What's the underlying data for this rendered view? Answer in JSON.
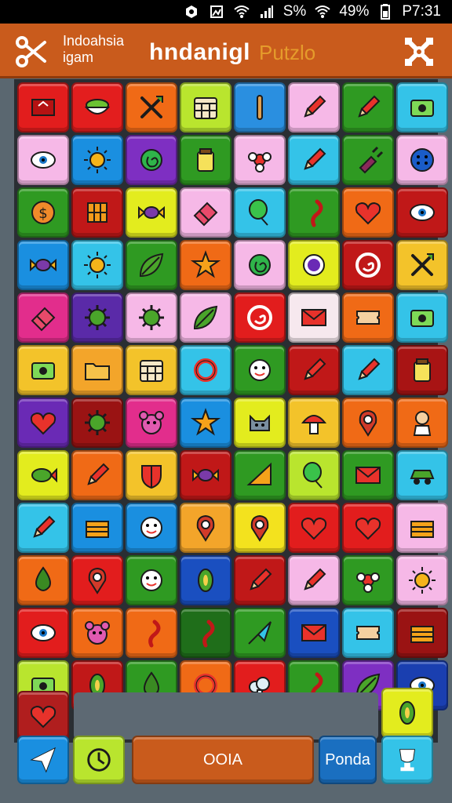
{
  "status_bar": {
    "signal_text": "S%",
    "battery": "49%",
    "time": "P7:31"
  },
  "header": {
    "app_name": "Indoahsia igam",
    "title": "hndanigl",
    "title_suffix": "Putzlo",
    "left_icon": "scissors-icon",
    "right_icon": "gear-icon"
  },
  "board": {
    "rows": [
      [
        {
          "c": "#e21d1d",
          "i": "badge"
        },
        {
          "c": "#e31e1e",
          "i": "bowl"
        },
        {
          "c": "#f06a16",
          "i": "crossed-arrows"
        },
        {
          "c": "#b9e52e",
          "i": "calendar"
        },
        {
          "c": "#2a8fe0",
          "i": "stick"
        },
        {
          "c": "#f6b8e7",
          "i": "pencil"
        },
        {
          "c": "#2f9a22",
          "i": "pencil"
        },
        {
          "c": "#34c3e8",
          "i": "camera"
        }
      ],
      [
        {
          "c": "#f6b8e7",
          "i": "eye"
        },
        {
          "c": "#1a8fe0",
          "i": "sun"
        },
        {
          "c": "#7e2fc2",
          "i": "spiral"
        },
        {
          "c": "#2f9a22",
          "i": "jar"
        },
        {
          "c": "#f6b8e7",
          "i": "flower"
        },
        {
          "c": "#34c3e8",
          "i": "pencil"
        },
        {
          "c": "#2f9a22",
          "i": "plug"
        },
        {
          "c": "#f6b8e7",
          "i": "button"
        }
      ],
      [
        {
          "c": "#2f9a22",
          "i": "coin"
        },
        {
          "c": "#c01818",
          "i": "grid"
        },
        {
          "c": "#e3ec1e",
          "i": "candy"
        },
        {
          "c": "#f6b8e7",
          "i": "eraser"
        },
        {
          "c": "#34c3e8",
          "i": "balloon"
        },
        {
          "c": "#2f9a22",
          "i": "hook"
        },
        {
          "c": "#f06a16",
          "i": "heart"
        },
        {
          "c": "#c01818",
          "i": "eye"
        }
      ],
      [
        {
          "c": "#1a8fe0",
          "i": "candy"
        },
        {
          "c": "#34c3e8",
          "i": "sun"
        },
        {
          "c": "#2f9a22",
          "i": "leaf"
        },
        {
          "c": "#f06a16",
          "i": "star"
        },
        {
          "c": "#f6b8e7",
          "i": "spiral"
        },
        {
          "c": "#e3ec1e",
          "i": "circle"
        },
        {
          "c": "#c01818",
          "i": "swirl"
        },
        {
          "c": "#f3c32a",
          "i": "crossed-arrows"
        }
      ],
      [
        {
          "c": "#e22d8c",
          "i": "eraser"
        },
        {
          "c": "#5a2aa8",
          "i": "germ"
        },
        {
          "c": "#f6b8e7",
          "i": "germ"
        },
        {
          "c": "#f6b8e7",
          "i": "leaf"
        },
        {
          "c": "#e21d1d",
          "i": "swirl"
        },
        {
          "c": "#f6e8ee",
          "i": "envelope"
        },
        {
          "c": "#f06a16",
          "i": "ticket"
        },
        {
          "c": "#34c3e8",
          "i": "camera"
        }
      ],
      [
        {
          "c": "#f3c32a",
          "i": "camera"
        },
        {
          "c": "#f3a52a",
          "i": "folder"
        },
        {
          "c": "#f3c32a",
          "i": "calendar"
        },
        {
          "c": "#34c3e8",
          "i": "ring"
        },
        {
          "c": "#2f9a22",
          "i": "face"
        },
        {
          "c": "#c01818",
          "i": "pencil"
        },
        {
          "c": "#34c3e8",
          "i": "pencil"
        },
        {
          "c": "#a81414",
          "i": "jar"
        }
      ],
      [
        {
          "c": "#6a2ab5",
          "i": "heart"
        },
        {
          "c": "#9a1313",
          "i": "germ"
        },
        {
          "c": "#e22d8c",
          "i": "bear"
        },
        {
          "c": "#1a8fe0",
          "i": "star"
        },
        {
          "c": "#e3ec1e",
          "i": "cat"
        },
        {
          "c": "#f3c32a",
          "i": "mushroom"
        },
        {
          "c": "#f06a16",
          "i": "pin"
        },
        {
          "c": "#f06a16",
          "i": "person"
        }
      ],
      [
        {
          "c": "#e3ec1e",
          "i": "fish"
        },
        {
          "c": "#f06a16",
          "i": "pencil"
        },
        {
          "c": "#f3c32a",
          "i": "shield"
        },
        {
          "c": "#c01818",
          "i": "candy"
        },
        {
          "c": "#2f9a22",
          "i": "triangle"
        },
        {
          "c": "#b9e52e",
          "i": "balloon"
        },
        {
          "c": "#2f9a22",
          "i": "envelope"
        },
        {
          "c": "#34c3e8",
          "i": "car"
        }
      ],
      [
        {
          "c": "#34c3e8",
          "i": "pencil"
        },
        {
          "c": "#1a8fe0",
          "i": "box"
        },
        {
          "c": "#1a8fe0",
          "i": "face"
        },
        {
          "c": "#f3a52a",
          "i": "pin"
        },
        {
          "c": "#f3e21e",
          "i": "pin"
        },
        {
          "c": "#e21d1d",
          "i": "heart"
        },
        {
          "c": "#e21d1d",
          "i": "heart"
        },
        {
          "c": "#f6b8e7",
          "i": "box"
        }
      ],
      [
        {
          "c": "#f06a16",
          "i": "drop"
        },
        {
          "c": "#e21d1d",
          "i": "pin"
        },
        {
          "c": "#2f9a22",
          "i": "face"
        },
        {
          "c": "#1a4fc0",
          "i": "bean"
        },
        {
          "c": "#c01818",
          "i": "pencil"
        },
        {
          "c": "#f6b8e7",
          "i": "pencil"
        },
        {
          "c": "#2f9a22",
          "i": "flower"
        },
        {
          "c": "#f6b8e7",
          "i": "sun"
        }
      ],
      [
        {
          "c": "#e21d1d",
          "i": "eye"
        },
        {
          "c": "#f06a16",
          "i": "bear"
        },
        {
          "c": "#f06a16",
          "i": "hook"
        },
        {
          "c": "#1f6e1a",
          "i": "hook"
        },
        {
          "c": "#2f9a22",
          "i": "arrow"
        },
        {
          "c": "#1a4fc0",
          "i": "envelope"
        },
        {
          "c": "#34c3e8",
          "i": "ticket"
        },
        {
          "c": "#9a1313",
          "i": "box"
        }
      ],
      [
        {
          "c": "#b9e52e",
          "i": "camera"
        },
        {
          "c": "#c01818",
          "i": "bean"
        },
        {
          "c": "#2f9a22",
          "i": "drop"
        },
        {
          "c": "#f06a16",
          "i": "ring"
        },
        {
          "c": "#e21d1d",
          "i": "bush"
        },
        {
          "c": "#2f9a22",
          "i": "hook"
        },
        {
          "c": "#7e2fc2",
          "i": "leaf"
        },
        {
          "c": "#1a3fb0",
          "i": "eye"
        }
      ]
    ]
  },
  "extra_tiles": {
    "bottom_left": {
      "c": "#b01e1e",
      "i": "heart"
    },
    "bottom_right": {
      "c": "#e3ec1e",
      "i": "bean"
    }
  },
  "bottom_bar": {
    "btn1": {
      "c": "#1a8fe0",
      "i": "send-icon"
    },
    "btn2": {
      "c": "#b9e52e",
      "i": "clock-icon"
    },
    "center_label": "OOIA",
    "center_color": "#c95b1c",
    "right_label": "Ponda",
    "right_color": "#1a6fc0",
    "btn_last": {
      "c": "#34c3e8",
      "i": "trophy-icon"
    }
  }
}
